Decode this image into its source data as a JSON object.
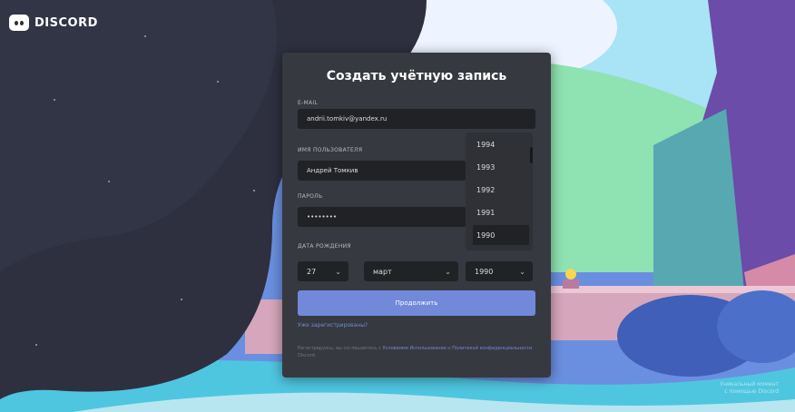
{
  "brand": {
    "name": "DISCORD"
  },
  "form": {
    "title": "Создать учётную запись",
    "email": {
      "label": "E-mail",
      "value": "andrii.tomkiv@yandex.ru"
    },
    "username": {
      "label": "Имя пользователя",
      "value": "Андрей Томкив"
    },
    "password": {
      "label": "Пароль",
      "value": "••••••••"
    },
    "dob": {
      "label": "Дата рождения",
      "day": "27",
      "month": "март",
      "year": "1990",
      "year_options": [
        "1994",
        "1993",
        "1992",
        "1991",
        "1990"
      ]
    },
    "continue_label": "Продолжить",
    "login_link": "Уже зарегистрированы?",
    "terms_text": "Регистрируясь, вы соглашаетесь с ",
    "terms_link": "Условиями Использования",
    "terms_and": " и ",
    "privacy_link": "Политикой конфиденциальности",
    "terms_end": " Discord."
  },
  "corner_text": {
    "line1": "Уникальный момент",
    "line2": "с помощью Discord"
  },
  "colors": {
    "accent": "#7289da",
    "modal_bg": "#36393f",
    "input_bg": "#202225",
    "space_bg": "#2b2d3b"
  }
}
